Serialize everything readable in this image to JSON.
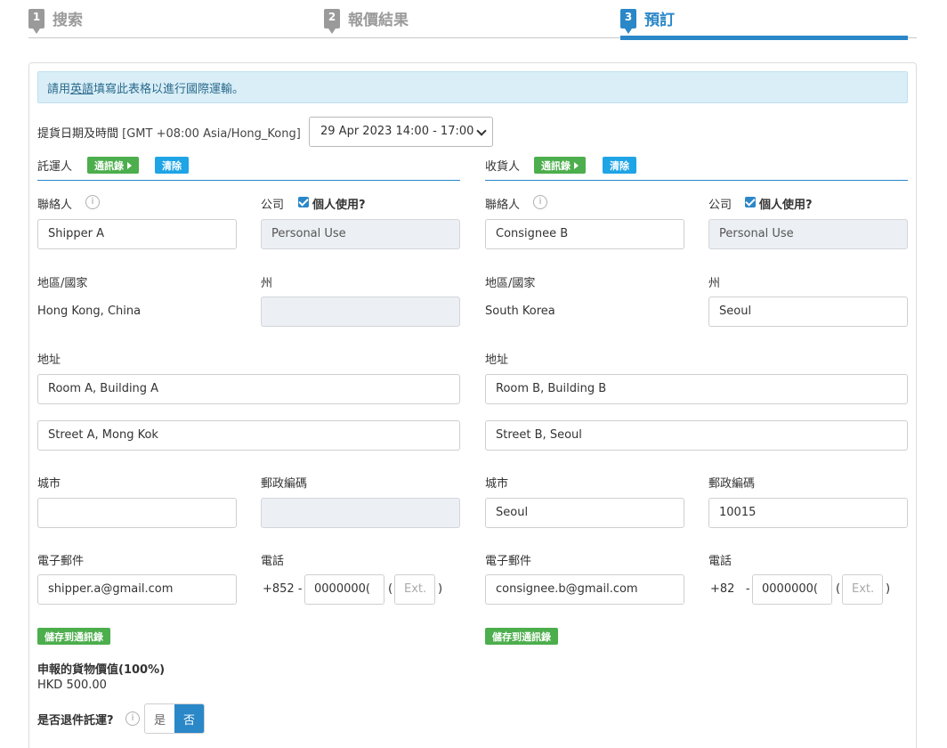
{
  "steps": [
    {
      "num": "1",
      "label": "搜索"
    },
    {
      "num": "2",
      "label": "報價結果"
    },
    {
      "num": "3",
      "label": "預訂"
    }
  ],
  "notice": {
    "prefix": "請用",
    "link": "英語",
    "suffix": "填寫此表格以進行國際運輸。"
  },
  "pickup": {
    "label": "提貨日期及時間",
    "timezone": "[GMT +08:00 Asia/Hong_Kong]",
    "selected": "29 Apr 2023 14:00 - 17:00"
  },
  "shipper": {
    "title": "託運人",
    "address_book": "通訊錄",
    "clear": "清除",
    "contact_label": "聯絡人",
    "contact": "Shipper A",
    "company_label": "公司",
    "personal_label": "個人使用?",
    "company": "Personal Use",
    "region_label": "地區/國家",
    "region": "Hong Kong, China",
    "state_label": "州",
    "state": "",
    "address_label": "地址",
    "address1": "Room A, Building A",
    "address2": "Street A, Mong Kok",
    "city_label": "城市",
    "city": "",
    "postcode_label": "郵政編碼",
    "postcode": "",
    "email_label": "電子郵件",
    "email": "shipper.a@gmail.com",
    "phone_label": "電話",
    "phone_code": "+852 -",
    "phone": "0000000(",
    "ext_placeholder": "Ext.",
    "save": "儲存到通訊錄"
  },
  "consignee": {
    "title": "收貨人",
    "address_book": "通訊錄",
    "clear": "清除",
    "contact_label": "聯絡人",
    "contact": "Consignee B",
    "company_label": "公司",
    "personal_label": "個人使用?",
    "company": "Personal Use",
    "region_label": "地區/國家",
    "region": "South Korea",
    "state_label": "州",
    "state": "Seoul",
    "address_label": "地址",
    "address1": "Room B, Building B",
    "address2": "Street B, Seoul",
    "city_label": "城市",
    "city": "Seoul",
    "postcode_label": "郵政編碼",
    "postcode": "10015",
    "email_label": "電子郵件",
    "email": "consignee.b@gmail.com",
    "phone_label": "電話",
    "phone_code": "+82   -",
    "phone": "0000000(",
    "ext_placeholder": "Ext.",
    "save": "儲存到通訊錄"
  },
  "declared": {
    "label": "申報的貨物價值(100%)",
    "value": "HKD 500.00"
  },
  "return": {
    "label": "是否退件託運?",
    "yes": "是",
    "no": "否",
    "selected": "否"
  },
  "colors": {
    "accent": "#2a87c8",
    "green": "#4cae4c",
    "light_blue": "#1fa4e6",
    "notice_bg": "#d9eef7"
  }
}
